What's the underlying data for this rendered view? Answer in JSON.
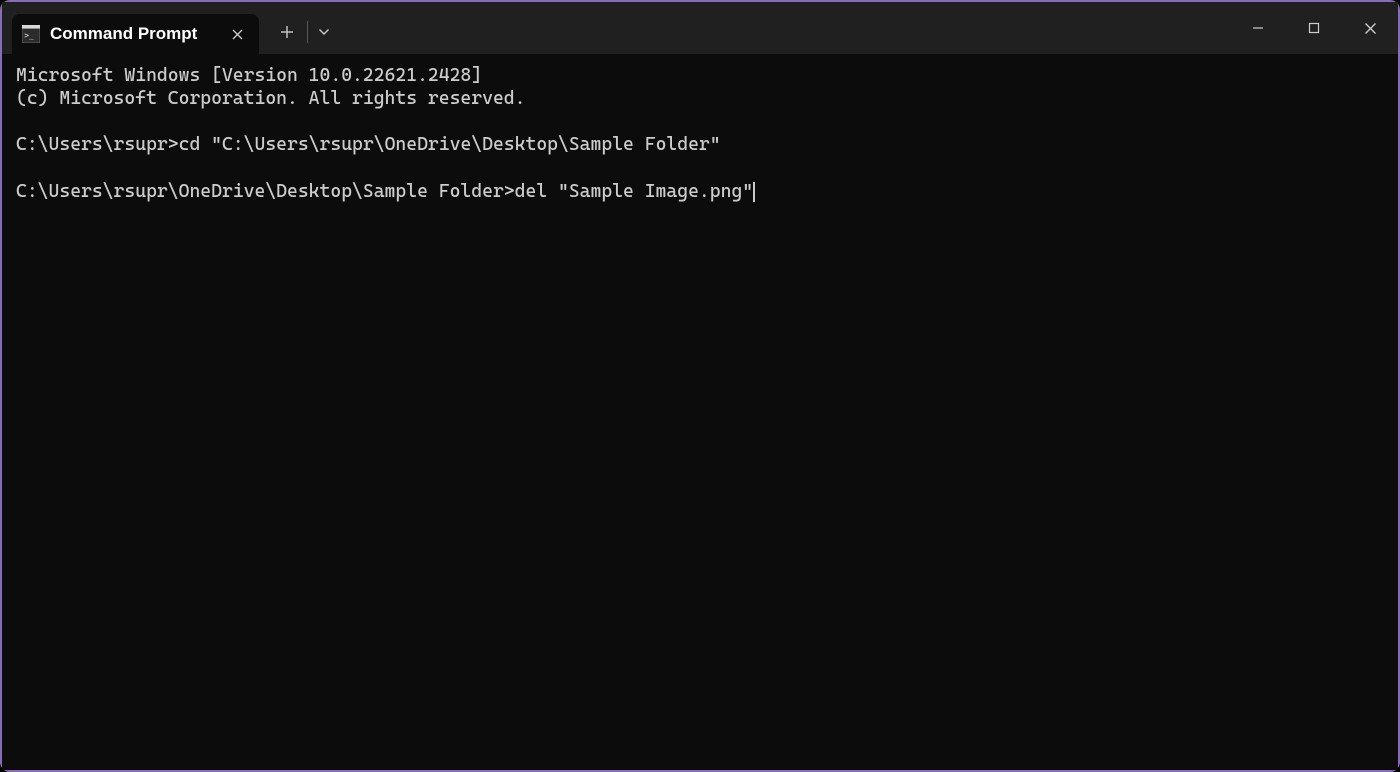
{
  "tab": {
    "title": "Command Prompt"
  },
  "terminal": {
    "banner_line1": "Microsoft Windows [Version 10.0.22621.2428]",
    "banner_line2": "(c) Microsoft Corporation. All rights reserved.",
    "line1_prompt": "C:\\Users\\rsupr>",
    "line1_cmd": "cd \"C:\\Users\\rsupr\\OneDrive\\Desktop\\Sample Folder\"",
    "line2_prompt": "C:\\Users\\rsupr\\OneDrive\\Desktop\\Sample Folder>",
    "line2_cmd": "del \"Sample Image.png\""
  }
}
